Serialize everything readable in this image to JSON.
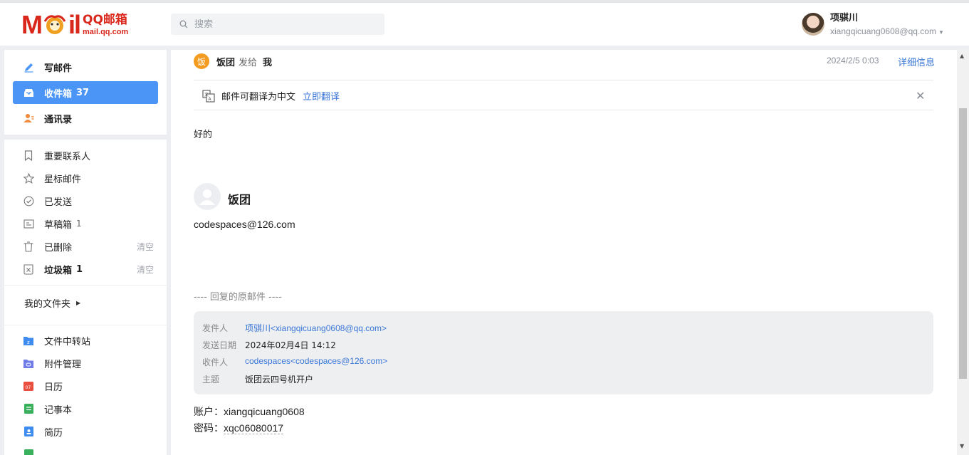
{
  "app": {
    "logo_mail": "M",
    "logo_mail_end": "il",
    "logo_name": "QQ邮箱",
    "logo_url": "mail.qq.com"
  },
  "search": {
    "placeholder": "搜索"
  },
  "user": {
    "name": "项骐川",
    "email": "xiangqicuang0608@qq.com"
  },
  "sidebar": {
    "primary": [
      {
        "label": "写邮件",
        "icon": "pen-icon"
      },
      {
        "label": "收件箱",
        "count": "37",
        "icon": "inbox-icon"
      },
      {
        "label": "通讯录",
        "icon": "contacts-icon"
      }
    ],
    "folders": [
      {
        "label": "重要联系人",
        "icon": "bookmark-icon"
      },
      {
        "label": "星标邮件",
        "icon": "star-icon"
      },
      {
        "label": "已发送",
        "icon": "check-circle-icon"
      },
      {
        "label": "草稿箱",
        "count": "1",
        "icon": "draft-icon"
      },
      {
        "label": "已删除",
        "action": "清空",
        "icon": "trash-icon"
      },
      {
        "label": "垃圾箱",
        "count": "1",
        "action": "清空",
        "icon": "spam-icon"
      }
    ],
    "my_folders": "我的文件夹",
    "apps": [
      {
        "label": "文件中转站",
        "icon": "file-transfer-icon",
        "color": "#3f8cf0"
      },
      {
        "label": "附件管理",
        "icon": "attachment-icon",
        "color": "#6f7ce8"
      },
      {
        "label": "日历",
        "icon": "calendar-icon",
        "color": "#e9503f",
        "badge": "07"
      },
      {
        "label": "记事本",
        "icon": "notepad-icon",
        "color": "#3aaf5c"
      },
      {
        "label": "简历",
        "icon": "resume-icon",
        "color": "#3f8cf0"
      }
    ]
  },
  "mail": {
    "sender_initial": "饭",
    "from": "饭团",
    "sent_to": "发给",
    "to": "我",
    "date": "2024/2/5 0:03",
    "detail": "详细信息",
    "translate_text": "邮件可翻译为中文",
    "translate_link": "立即翻译",
    "body": "好的",
    "signature_name": "饭团",
    "signature_email": "codespaces@126.com",
    "quote_title": "---- 回复的原邮件 ----",
    "quote": [
      {
        "label": "发件人",
        "value": "项骐川<xiangqicuang0608@qq.com>",
        "link": true
      },
      {
        "label": "发送日期",
        "value": "2024年02月4日 14:12",
        "link": false
      },
      {
        "label": "收件人",
        "value": "codespaces<codespaces@126.com>",
        "link": true
      },
      {
        "label": "主题",
        "value": "饭团云四号机开户",
        "link": false
      }
    ],
    "account_label": "账户：",
    "account_value": "xiangqicuang0608",
    "password_label": "密码：",
    "password_value": "xqc06080017"
  },
  "colors": {
    "accent": "#4a95f5",
    "brand": "#d9271b",
    "link": "#3a76d6"
  }
}
